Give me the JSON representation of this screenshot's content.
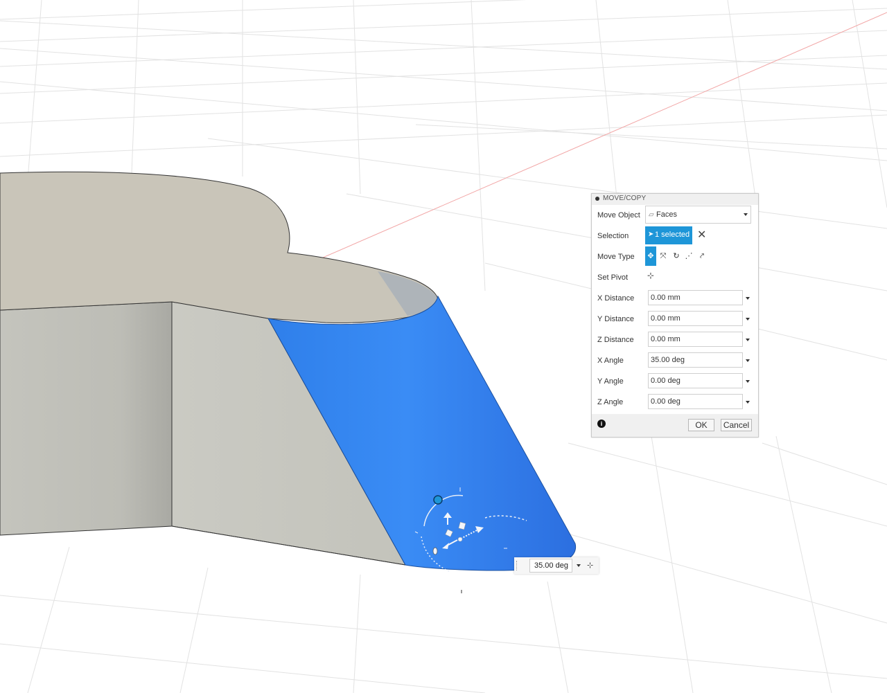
{
  "dialog": {
    "title": "MOVE/COPY",
    "move_object": {
      "label": "Move Object",
      "value": "Faces"
    },
    "selection": {
      "label": "Selection",
      "value": "1 selected"
    },
    "move_type": {
      "label": "Move Type",
      "active_index": 0,
      "icons": [
        "free-move-icon",
        "translate-icon",
        "rotate-icon",
        "point-to-point-icon",
        "point-to-position-icon"
      ]
    },
    "set_pivot": {
      "label": "Set Pivot"
    },
    "x_distance": {
      "label": "X Distance",
      "value": "0.00 mm"
    },
    "y_distance": {
      "label": "Y Distance",
      "value": "0.00 mm"
    },
    "z_distance": {
      "label": "Z Distance",
      "value": "0.00 mm"
    },
    "x_angle": {
      "label": "X Angle",
      "value": "35.00 deg"
    },
    "y_angle": {
      "label": "Y Angle",
      "value": "0.00 deg"
    },
    "z_angle": {
      "label": "Z Angle",
      "value": "0.00 deg"
    },
    "ok_label": "OK",
    "cancel_label": "Cancel"
  },
  "canvas_input": {
    "value": "35.00 deg"
  },
  "colors": {
    "selected_face": "#2f7fea",
    "accent": "#1e96d8",
    "body": "#c8c8c0",
    "top_face": "#c9c5b9"
  }
}
